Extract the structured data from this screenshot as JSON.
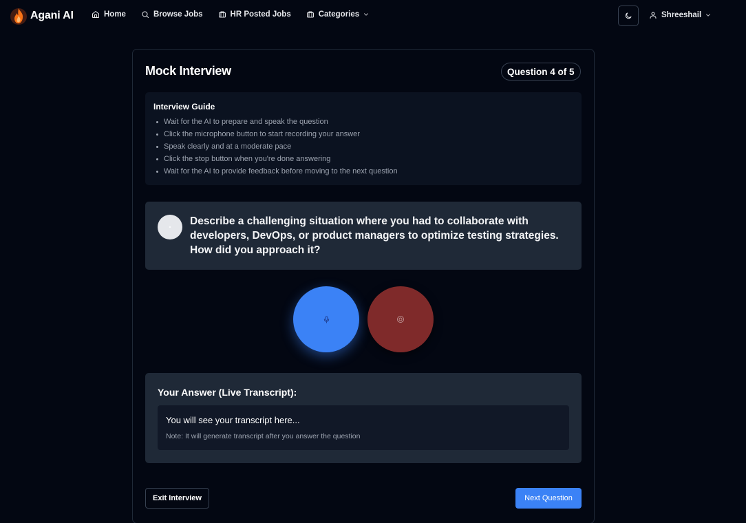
{
  "brand": {
    "name": "Agani AI",
    "logo_icon": "flame-logo-icon",
    "accent": "#f97316"
  },
  "nav": {
    "items": [
      {
        "label": "Home",
        "icon": "home-icon"
      },
      {
        "label": "Browse Jobs",
        "icon": "search-icon"
      },
      {
        "label": "HR Posted Jobs",
        "icon": "briefcase-icon"
      },
      {
        "label": "Categories",
        "icon": "briefcase-icon",
        "has_dropdown": true
      }
    ],
    "theme_toggle_icon": "moon-icon",
    "user": {
      "name": "Shreeshail",
      "icon": "user-icon"
    }
  },
  "interview": {
    "title": "Mock Interview",
    "progress": "Question 4 of 5",
    "guide": {
      "title": "Interview Guide",
      "items": [
        "Wait for the AI to prepare and speak the question",
        "Click the microphone button to start recording your answer",
        "Speak clearly and at a moderate pace",
        "Click the stop button when you're done answering",
        "Wait for the AI to provide feedback before moving to the next question"
      ]
    },
    "question": "Describe a challenging situation where you had to collaborate with developers, DevOps, or product managers to optimize testing strategies. How did you approach it?",
    "controls": {
      "mic_icon": "microphone-icon",
      "stop_icon": "stop-record-icon",
      "mic_color": "#3b82f6",
      "stop_color": "#7f2a2a"
    },
    "answer": {
      "title": "Your Answer (Live Transcript):",
      "placeholder": "You will see your transcript here...",
      "note": "Note: It will generate transcript after you answer the question"
    },
    "actions": {
      "exit_label": "Exit Interview",
      "next_label": "Next Question"
    }
  }
}
